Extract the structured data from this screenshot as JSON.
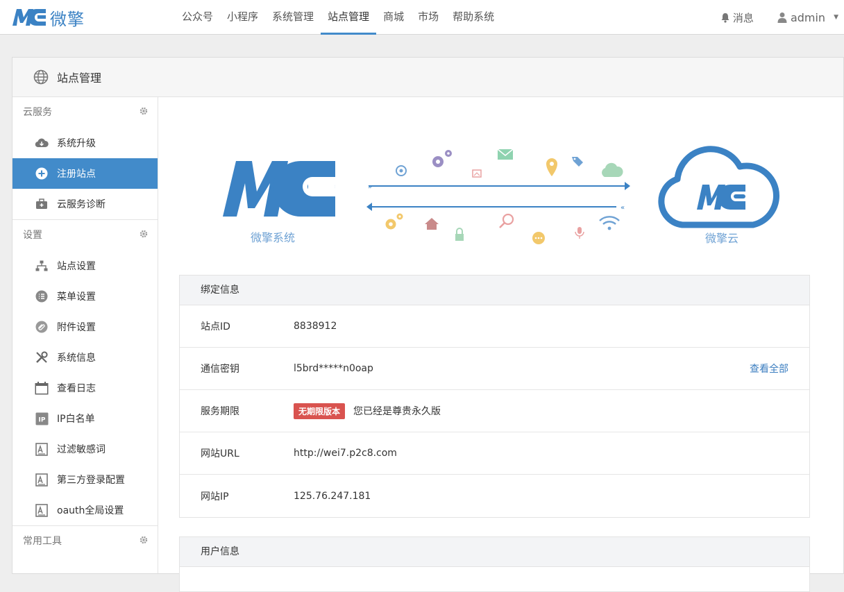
{
  "header": {
    "logo_text": "微擎",
    "nav": [
      {
        "label": "公众号"
      },
      {
        "label": "小程序"
      },
      {
        "label": "系统管理"
      },
      {
        "label": "站点管理",
        "active": true
      },
      {
        "label": "商城"
      },
      {
        "label": "市场"
      },
      {
        "label": "帮助系统"
      }
    ],
    "messages_label": "消息",
    "user_label": "admin"
  },
  "panel": {
    "title": "站点管理"
  },
  "sidebar": {
    "groups": [
      {
        "title": "云服务",
        "items": [
          {
            "label": "系统升级",
            "icon": "cloud-download-icon"
          },
          {
            "label": "注册站点",
            "icon": "plus-circle-icon",
            "active": true
          },
          {
            "label": "云服务诊断",
            "icon": "medkit-icon"
          }
        ]
      },
      {
        "title": "设置",
        "items": [
          {
            "label": "站点设置",
            "icon": "sitemap-icon"
          },
          {
            "label": "菜单设置",
            "icon": "list-icon"
          },
          {
            "label": "附件设置",
            "icon": "paperclip-icon"
          },
          {
            "label": "系统信息",
            "icon": "tools-icon"
          },
          {
            "label": "查看日志",
            "icon": "calendar-icon"
          },
          {
            "label": "IP白名单",
            "icon": "ip-icon"
          },
          {
            "label": "过滤敏感词",
            "icon": "document-icon"
          },
          {
            "label": "第三方登录配置",
            "icon": "document-icon"
          },
          {
            "label": "oauth全局设置",
            "icon": "document-icon"
          }
        ]
      },
      {
        "title": "常用工具",
        "items": []
      }
    ]
  },
  "hero": {
    "left_caption": "微擎系统",
    "right_caption": "微擎云"
  },
  "bind_info": {
    "title": "绑定信息",
    "rows": [
      {
        "key": "站点ID",
        "value": "8838912"
      },
      {
        "key": "通信密钥",
        "value": "l5brd*****n0oap",
        "link": "查看全部"
      },
      {
        "key": "服务期限",
        "badge": "无期限版本",
        "value": "您已经是尊贵永久版"
      },
      {
        "key": "网站URL",
        "value": "http://wei7.p2c8.com"
      },
      {
        "key": "网站IP",
        "value": "125.76.247.181"
      }
    ]
  },
  "user_info": {
    "title": "用户信息"
  },
  "colors": {
    "accent": "#428bca",
    "logo_blue": "#3b82c4",
    "badge_red": "#d9534f",
    "link_blue": "#3b7ec0"
  }
}
